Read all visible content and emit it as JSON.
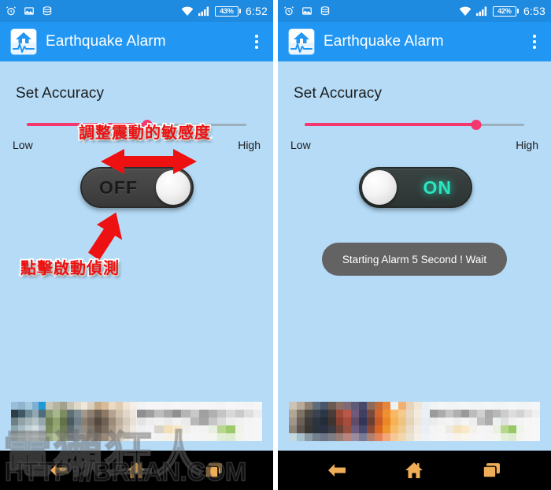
{
  "app": {
    "title": "Earthquake Alarm",
    "icon_name": "earthquake-house-wave-icon",
    "accent_blue": "#2196f3",
    "statusbar_blue": "#1e8ae0",
    "content_bg": "#b5dbf7",
    "slider_pink": "#f5376e",
    "on_green": "#28e8c2",
    "nav_orange": "#f0ad57"
  },
  "panels": [
    {
      "id": "left",
      "statusbar": {
        "icons": [
          "alarm-clock-icon",
          "image-icon",
          "sd-card-stack-icon"
        ],
        "wifi_icon": "wifi-icon",
        "signal_icon": "cell-signal-icon",
        "battery_percent": "43%",
        "time": "6:52"
      },
      "header": {
        "title": "Earthquake Alarm",
        "menu_icon": "overflow-menu-icon"
      },
      "accuracy_label": "Set Accuracy",
      "slider": {
        "value_percent": 55,
        "min_label": "Low",
        "max_label": "High"
      },
      "toggle": {
        "state": "OFF",
        "label": "OFF",
        "knob_side": "right"
      },
      "toast": null,
      "annotations": [
        {
          "name": "adjust-sensitivity-note",
          "text": "調整震動的敏感度"
        },
        {
          "name": "tap-to-start-note",
          "text": "點擊啟動偵測"
        }
      ],
      "navbar": {
        "back": "back-icon",
        "home": "home-icon",
        "recents": "recents-icon"
      }
    },
    {
      "id": "right",
      "statusbar": {
        "icons": [
          "alarm-clock-icon",
          "image-icon",
          "sd-card-stack-icon"
        ],
        "wifi_icon": "wifi-icon",
        "signal_icon": "cell-signal-icon",
        "battery_percent": "42%",
        "time": "6:53"
      },
      "header": {
        "title": "Earthquake Alarm",
        "menu_icon": "overflow-menu-icon"
      },
      "accuracy_label": "Set Accuracy",
      "slider": {
        "value_percent": 78,
        "min_label": "Low",
        "max_label": "High"
      },
      "toggle": {
        "state": "ON",
        "label": "ON",
        "knob_side": "left"
      },
      "toast": {
        "message": "Starting Alarm 5 Second ! Wait"
      },
      "annotations": [],
      "navbar": {
        "back": "back-icon",
        "home": "home-icon",
        "recents": "recents-icon"
      }
    }
  ],
  "watermark": {
    "cjk": "電獺狂人",
    "url": "HTTP://BRIIAN.COM"
  }
}
